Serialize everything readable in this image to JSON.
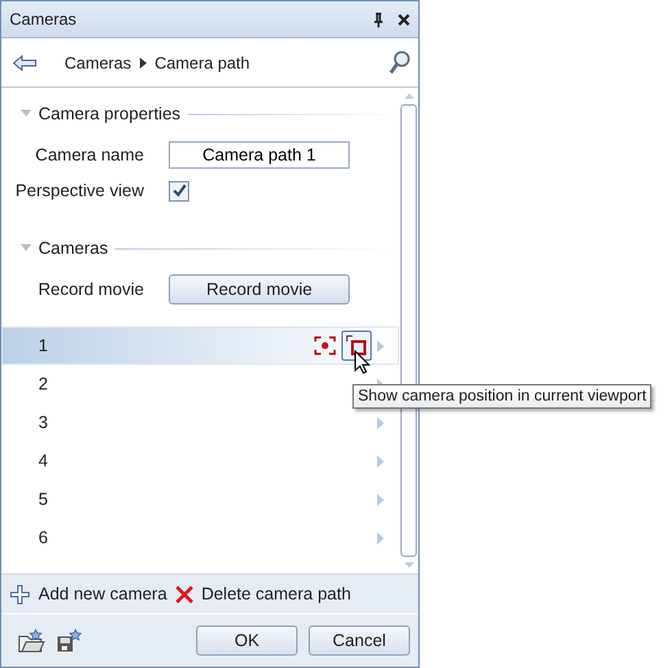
{
  "window": {
    "title": "Cameras"
  },
  "breadcrumb": [
    "Cameras",
    "Camera path"
  ],
  "sections": [
    {
      "title": "Camera properties",
      "expanded": true,
      "fields": [
        {
          "kind": "text",
          "label": "Camera name",
          "value": "Camera path 1"
        },
        {
          "kind": "checkbox",
          "label": "Perspective view",
          "checked": true
        }
      ]
    },
    {
      "title": "Cameras",
      "expanded": true,
      "fields": [
        {
          "kind": "button",
          "label": "Record movie",
          "button": "Record movie"
        }
      ]
    }
  ],
  "cameras": [
    {
      "label": "1",
      "selected": true
    },
    {
      "label": "2",
      "selected": false
    },
    {
      "label": "3",
      "selected": false
    },
    {
      "label": "4",
      "selected": false
    },
    {
      "label": "5",
      "selected": false
    },
    {
      "label": "6",
      "selected": false
    }
  ],
  "tooltip": "Show camera position in current viewport",
  "actions": [
    {
      "kind": "add",
      "label": "Add new camera"
    },
    {
      "kind": "delete",
      "label": "Delete camera path"
    }
  ],
  "buttons": [
    "OK",
    "Cancel"
  ]
}
